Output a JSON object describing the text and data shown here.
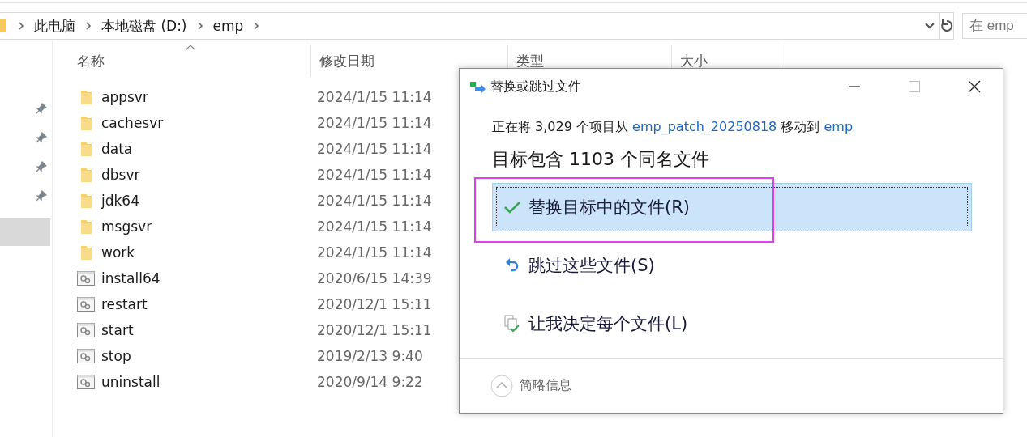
{
  "address_bar": {
    "breadcrumb": [
      "此电脑",
      "本地磁盘 (D:)",
      "emp"
    ]
  },
  "search": {
    "placeholder": "在 emp"
  },
  "columns": [
    "名称",
    "修改日期",
    "类型",
    "大小"
  ],
  "files": [
    {
      "name": "appsvr",
      "modified": "2024/1/15 11:14",
      "kind": "folder"
    },
    {
      "name": "cachesvr",
      "modified": "2024/1/15 11:14",
      "kind": "folder"
    },
    {
      "name": "data",
      "modified": "2024/1/15 11:14",
      "kind": "folder"
    },
    {
      "name": "dbsvr",
      "modified": "2024/1/15 11:14",
      "kind": "folder"
    },
    {
      "name": "jdk64",
      "modified": "2024/1/15 11:14",
      "kind": "folder"
    },
    {
      "name": "msgsvr",
      "modified": "2024/1/15 11:14",
      "kind": "folder"
    },
    {
      "name": "work",
      "modified": "2024/1/15 11:14",
      "kind": "folder"
    },
    {
      "name": "install64",
      "modified": "2020/6/15 14:39",
      "kind": "script"
    },
    {
      "name": "restart",
      "modified": "2020/12/1 15:11",
      "kind": "script"
    },
    {
      "name": "start",
      "modified": "2020/12/1 15:11",
      "kind": "script"
    },
    {
      "name": "stop",
      "modified": "2019/2/13 9:40",
      "kind": "script"
    },
    {
      "name": "uninstall",
      "modified": "2020/9/14 9:22",
      "kind": "script"
    }
  ],
  "dialog": {
    "title": "替换或跳过文件",
    "message": [
      {
        "kind": "text",
        "text": "正在将 3,029 个项目从"
      },
      {
        "kind": "link",
        "text": "emp_patch_20250818"
      },
      {
        "kind": "text",
        "text": "移动到"
      },
      {
        "kind": "link",
        "text": "emp"
      }
    ],
    "heading": "目标包含 1103 个同名文件",
    "options": [
      {
        "kind": "replace",
        "label": "替换目标中的文件(R)",
        "selected": true
      },
      {
        "kind": "skip",
        "label": "跳过这些文件(S)",
        "selected": false
      },
      {
        "kind": "decide",
        "label": "让我决定每个文件(L)",
        "selected": false
      }
    ],
    "details": "简略信息"
  }
}
